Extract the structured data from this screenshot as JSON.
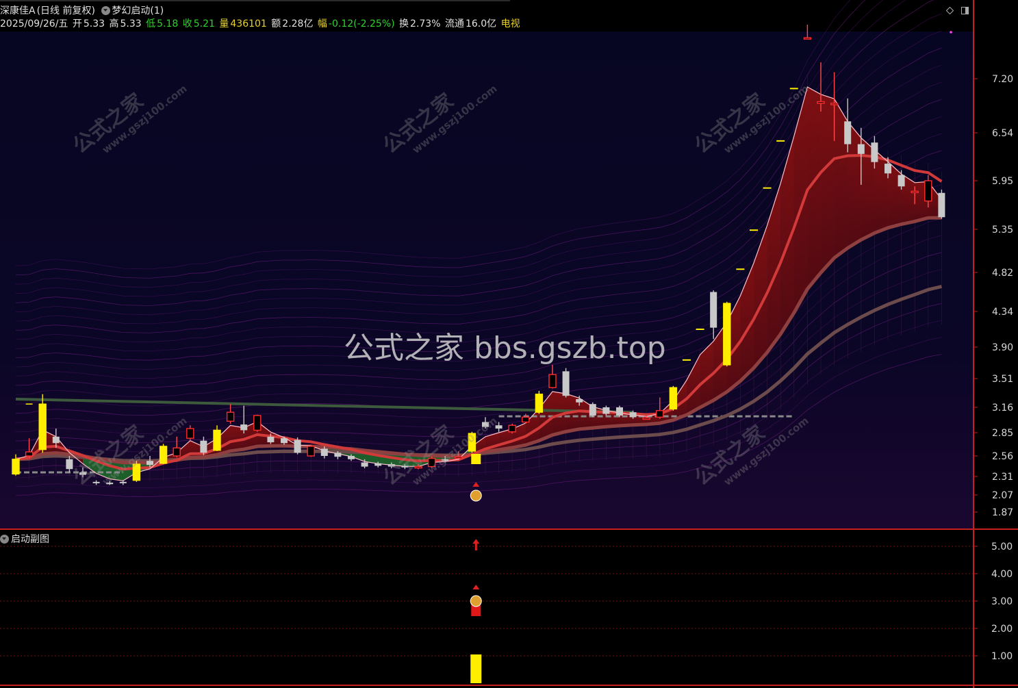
{
  "header": {
    "stock_name": "深康佳A",
    "period": "(日线 前复权)",
    "indicator": "梦幻启动(1)",
    "date": "2025/09/26/五",
    "open_label": "开",
    "open": "5.33",
    "high_label": "高",
    "high": "5.33",
    "low_label": "低",
    "low": "5.18",
    "close_label": "收",
    "close": "5.21",
    "volume_label": "量",
    "volume": "436101",
    "amount_label": "额",
    "amount": "2.28亿",
    "change_label": "幅",
    "change": "-0.12(-2.25%)",
    "turnover_label": "换",
    "turnover": "2.73%",
    "float_label": "流通",
    "float": "16.0亿",
    "sector": "电视"
  },
  "subchart": {
    "title": "启动副图"
  },
  "watermark": {
    "center": "公式之家 bbs.gszb.top",
    "tile_cn": "公式之家",
    "tile_url": "www.gszj100.com"
  },
  "colors": {
    "up": "#ff2b2b",
    "down": "#c8c8c8",
    "signal": "#ffee00",
    "axis": "#c81e1e",
    "bg_main": "#06061c",
    "bg_sub": "#000000"
  },
  "chart_data": [
    {
      "type": "candlestick",
      "title": "",
      "ylim": [
        1.8,
        7.6
      ],
      "y_ticks": [
        "7.20",
        "6.54",
        "5.95",
        "5.35",
        "4.82",
        "4.34",
        "3.90",
        "3.51",
        "3.16",
        "2.85",
        "2.56",
        "2.31",
        "2.07",
        "1.87"
      ],
      "y_tick_values": [
        7.2,
        6.54,
        5.95,
        5.35,
        4.82,
        4.34,
        3.9,
        3.51,
        3.16,
        2.85,
        2.56,
        2.31,
        2.07,
        1.87
      ],
      "candles": [
        [
          2.34,
          2.52,
          2.58,
          2.32
        ],
        [
          2.56,
          2.61,
          2.78,
          2.54
        ],
        [
          2.64,
          3.2,
          3.32,
          2.6
        ],
        [
          2.8,
          2.72,
          2.9,
          2.66
        ],
        [
          2.52,
          2.4,
          2.56,
          2.36
        ],
        [
          2.36,
          2.33,
          2.42,
          2.3
        ],
        [
          2.24,
          2.23,
          2.26,
          2.2
        ],
        [
          2.23,
          2.21,
          2.25,
          2.2
        ],
        [
          2.24,
          2.23,
          2.26,
          2.2
        ],
        [
          2.26,
          2.46,
          2.5,
          2.24
        ],
        [
          2.5,
          2.45,
          2.56,
          2.42
        ],
        [
          2.47,
          2.68,
          2.71,
          2.46
        ],
        [
          2.56,
          2.66,
          2.8,
          2.54
        ],
        [
          2.78,
          2.9,
          2.94,
          2.76
        ],
        [
          2.75,
          2.6,
          2.8,
          2.57
        ],
        [
          2.63,
          2.88,
          2.94,
          2.62
        ],
        [
          2.99,
          3.1,
          3.2,
          2.96
        ],
        [
          2.95,
          2.88,
          3.18,
          2.84
        ],
        [
          2.88,
          3.06,
          3.07,
          2.86
        ],
        [
          2.8,
          2.73,
          2.84,
          2.71
        ],
        [
          2.78,
          2.72,
          2.8,
          2.7
        ],
        [
          2.76,
          2.6,
          2.79,
          2.58
        ],
        [
          2.56,
          2.68,
          2.7,
          2.55
        ],
        [
          2.65,
          2.56,
          2.68,
          2.53
        ],
        [
          2.6,
          2.55,
          2.62,
          2.52
        ],
        [
          2.56,
          2.52,
          2.58,
          2.5
        ],
        [
          2.48,
          2.43,
          2.52,
          2.41
        ],
        [
          2.47,
          2.44,
          2.49,
          2.42
        ],
        [
          2.46,
          2.43,
          2.48,
          2.41
        ],
        [
          2.44,
          2.42,
          2.46,
          2.4
        ],
        [
          2.43,
          2.43,
          2.46,
          2.4
        ],
        [
          2.43,
          2.53,
          2.55,
          2.42
        ],
        [
          2.52,
          2.5,
          2.56,
          2.48
        ],
        [
          2.54,
          2.55,
          2.62,
          2.53
        ],
        [
          2.62,
          2.84,
          2.86,
          2.6
        ],
        [
          2.98,
          2.92,
          3.04,
          2.9
        ],
        [
          2.94,
          2.9,
          2.98,
          2.86
        ],
        [
          2.86,
          2.94,
          2.96,
          2.84
        ],
        [
          2.98,
          3.04,
          3.08,
          2.96
        ],
        [
          3.1,
          3.32,
          3.36,
          3.08
        ],
        [
          3.4,
          3.56,
          3.68,
          3.39
        ],
        [
          3.6,
          3.3,
          3.64,
          3.28
        ],
        [
          3.26,
          3.22,
          3.3,
          3.18
        ],
        [
          3.2,
          3.06,
          3.22,
          3.04
        ],
        [
          3.16,
          3.08,
          3.18,
          3.06
        ],
        [
          3.16,
          3.06,
          3.18,
          3.04
        ],
        [
          3.1,
          3.04,
          3.12,
          3.02
        ],
        [
          3.03,
          3.03,
          3.05,
          3.01
        ],
        [
          3.04,
          3.12,
          3.28,
          3.02
        ],
        [
          3.14,
          3.4,
          3.42,
          3.12
        ],
        [
          3.74,
          3.74,
          3.74,
          3.74
        ],
        [
          4.12,
          4.12,
          4.12,
          4.12
        ],
        [
          4.58,
          4.14,
          4.6,
          4.0
        ],
        [
          3.68,
          4.44,
          4.46,
          3.66
        ],
        [
          4.86,
          4.86,
          4.86,
          4.86
        ],
        [
          5.34,
          5.34,
          5.34,
          5.34
        ],
        [
          5.86,
          5.86,
          5.86,
          5.86
        ],
        [
          6.44,
          6.44,
          6.44,
          6.44
        ],
        [
          7.08,
          7.08,
          7.08,
          7.08
        ],
        [
          7.7,
          7.7,
          7.86,
          7.7
        ],
        [
          6.9,
          6.92,
          7.4,
          6.8
        ],
        [
          6.9,
          6.9,
          7.28,
          6.44
        ],
        [
          6.68,
          6.4,
          6.96,
          6.3
        ],
        [
          6.4,
          6.28,
          6.6,
          5.9
        ],
        [
          6.42,
          6.18,
          6.5,
          6.1
        ],
        [
          6.16,
          6.04,
          6.24,
          5.98
        ],
        [
          6.02,
          5.88,
          6.08,
          5.84
        ],
        [
          5.82,
          5.82,
          5.88,
          5.66
        ],
        [
          5.7,
          5.95,
          6.02,
          5.62
        ],
        [
          5.8,
          5.5,
          5.84,
          5.48
        ]
      ]
    },
    {
      "type": "bar",
      "title": "",
      "ylim": [
        0,
        5.4
      ],
      "y_ticks": [
        "5.00",
        "4.00",
        "3.00",
        "2.00",
        "1.00"
      ],
      "y_tick_values": [
        5,
        4,
        3,
        2,
        1
      ]
    }
  ]
}
